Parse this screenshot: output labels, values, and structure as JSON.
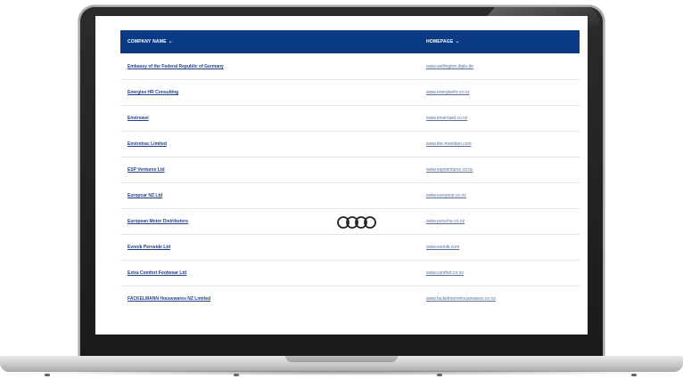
{
  "table": {
    "columns": {
      "company": "COMPANY NAME",
      "homepage": "HOMEPAGE"
    },
    "rows": [
      {
        "company": "Embassy of the Federal Republic of Germany",
        "homepage": "www.wellington.diplo.de"
      },
      {
        "company": "Energise HR Consulting",
        "homepage": "www.energisehr.co.nz"
      },
      {
        "company": "Envirowel",
        "homepage": "www.envirowel.co.nz"
      },
      {
        "company": "Envirotrac Limited",
        "homepage": "www.the-meridian.com"
      },
      {
        "company": "ESP Ventures Ltd",
        "homepage": "www.espventures.co.nz"
      },
      {
        "company": "Europcar NZ Ltd",
        "homepage": "www.europcar.co.nz"
      },
      {
        "company": "European Motor Distributors",
        "homepage": "www.porsche.co.nz"
      },
      {
        "company": "Evonik Peroxide Ltd",
        "homepage": "www.evonik.com"
      },
      {
        "company": "Extra Comfort Footwear Ltd",
        "homepage": "www.comfort.co.nz"
      },
      {
        "company": "FACKELMANN Housewares NZ Limited",
        "homepage": "www.fackelmannhousewares.co.nz"
      }
    ]
  },
  "icons": {
    "logo": "four-rings-logo",
    "sort": "chevron-down-icon"
  },
  "colors": {
    "header_bg": "#0b3a84",
    "link": "#1f3f86",
    "bezel": "#1a1a1a"
  }
}
